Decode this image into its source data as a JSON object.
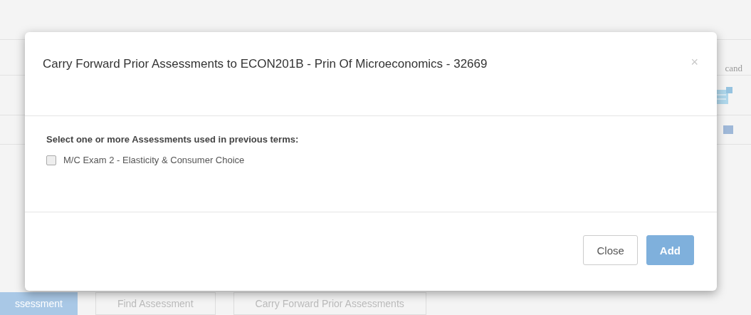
{
  "background": {
    "column_header": "cand",
    "buttons": [
      {
        "label": "ssessment",
        "primary": true
      },
      {
        "label": "Find Assessment",
        "primary": false
      },
      {
        "label": "Carry Forward Prior Assessments",
        "primary": false
      }
    ]
  },
  "modal": {
    "title": "Carry Forward Prior Assessments to ECON201B - Prin Of Microeconomics - 32669",
    "close_glyph": "×",
    "prompt": "Select one or more Assessments used in previous terms:",
    "assessments": [
      {
        "label": "M/C Exam 2 - Elasticity & Consumer Choice",
        "checked": false
      }
    ],
    "buttons": [
      {
        "label": "Close",
        "kind": "default"
      },
      {
        "label": "Add",
        "kind": "primary"
      }
    ]
  }
}
